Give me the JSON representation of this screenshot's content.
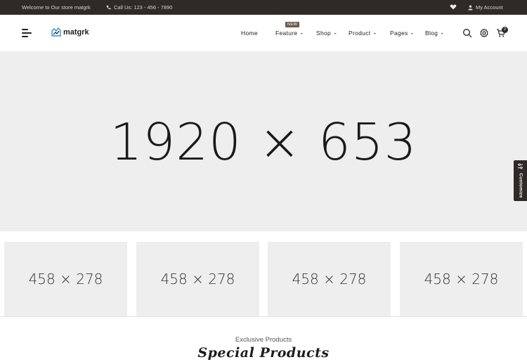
{
  "topbar": {
    "welcome": "Welcome to Our store matgrk",
    "phone": "Call Us: 123 - 456 - 7890",
    "account": "My Account"
  },
  "header": {
    "logo_text": "matgrk",
    "nav": [
      {
        "label": "Home",
        "has_dropdown": false
      },
      {
        "label": "Feature",
        "has_dropdown": true,
        "badge": "NEW"
      },
      {
        "label": "Shop",
        "has_dropdown": true
      },
      {
        "label": "Product",
        "has_dropdown": true
      },
      {
        "label": "Pages",
        "has_dropdown": true
      },
      {
        "label": "Blog",
        "has_dropdown": true
      }
    ],
    "icons": [
      "search-icon",
      "settings-icon",
      "cart-icon"
    ],
    "cart_count": "2"
  },
  "hero": {
    "placeholder": "1920 × 653"
  },
  "banners": [
    {
      "placeholder": "458 × 278"
    },
    {
      "placeholder": "458 × 278"
    },
    {
      "placeholder": "458 × 278"
    },
    {
      "placeholder": "458 × 278"
    }
  ],
  "customize": {
    "label": "Customize"
  },
  "section": {
    "subtitle": "Exclusive Products",
    "title": "Special Products"
  },
  "colors": {
    "topbar_bg": "#2e2a27",
    "placeholder_bg": "#eeeeee",
    "badge_bg": "#6b5b4f",
    "logo_accent": "#2d8fd5"
  }
}
